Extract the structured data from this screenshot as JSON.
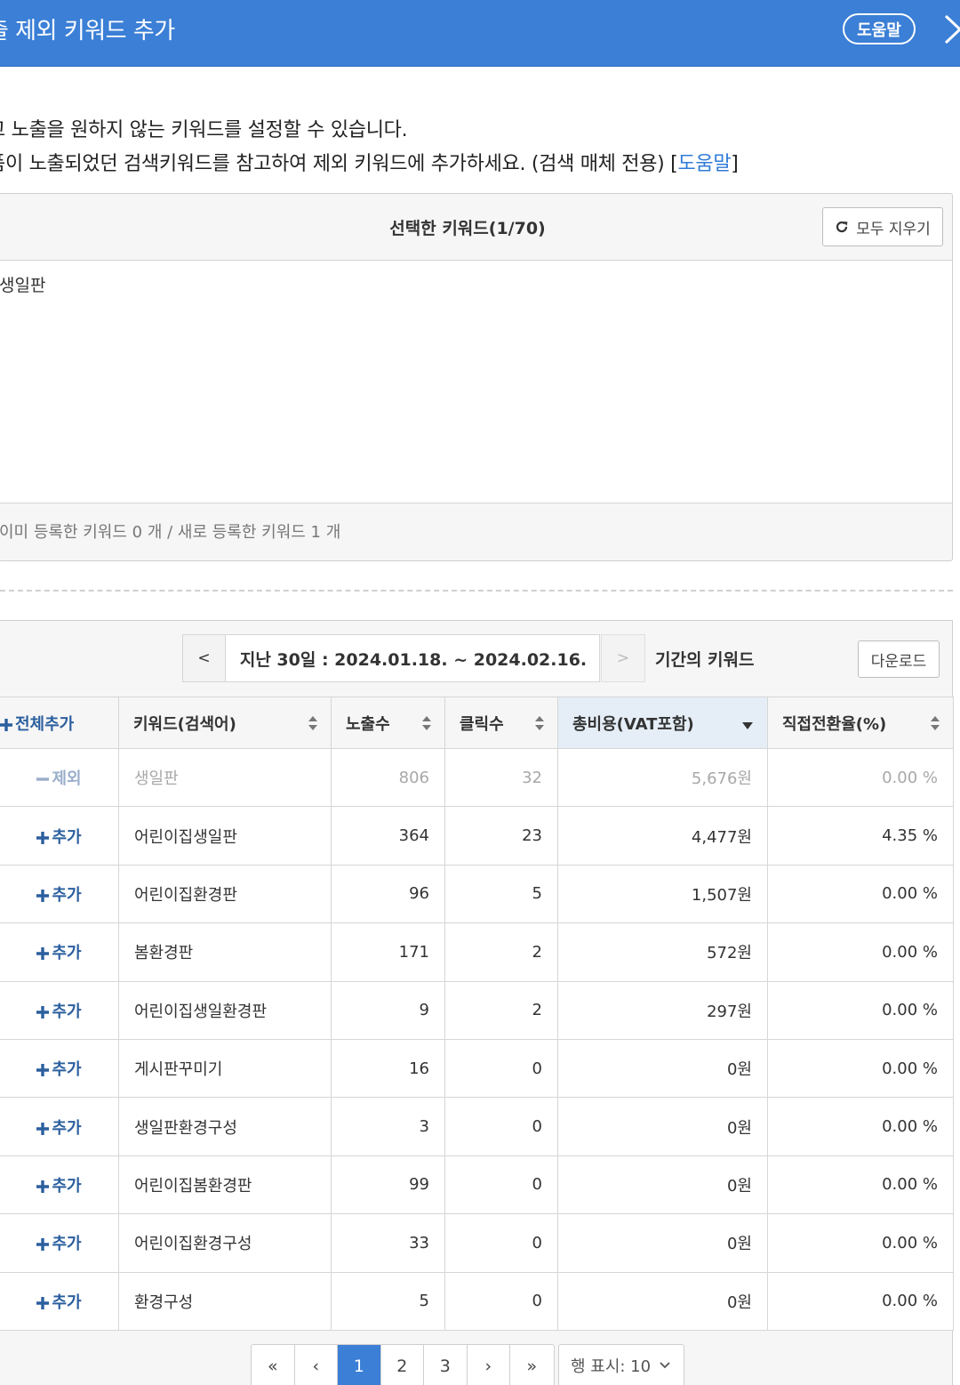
{
  "header": {
    "title": "출 제외 키워드 추가",
    "help_label": "도움말"
  },
  "description": {
    "line1": "고 노출을 원하지 않는 키워드를 설정할 수 있습니다.",
    "line2_text": "품이 노출되었던 검색키워드를 참고하여 제외 키워드에 추가하세요. (검색 매체 전용) [",
    "line2_link": "도움말",
    "line2_end": "]"
  },
  "selected": {
    "title": "선택한 키워드(1/70)",
    "clear_label": "모두 지우기",
    "keywords": [
      "생일판"
    ],
    "footer": "이미 등록한 키워드 0 개 / 새로 등록한 키워드 1 개"
  },
  "period": {
    "prev": "<",
    "range": "지난 30일 : 2024.01.18. ~ 2024.02.16.",
    "next": ">",
    "label": "기간의 키워드",
    "download_label": "다운로드"
  },
  "table": {
    "headers": {
      "add_all": "전체추가",
      "keyword": "키워드(검색어)",
      "impressions": "노출수",
      "clicks": "클릭수",
      "cost": "총비용(VAT포함)",
      "conversion": "직접전환율(%)"
    },
    "rows": [
      {
        "action": "제외",
        "keyword": "생일판",
        "impressions": "806",
        "clicks": "32",
        "cost": "5,676원",
        "conversion": "0.00 %"
      },
      {
        "action": "추가",
        "keyword": "어린이집생일판",
        "impressions": "364",
        "clicks": "23",
        "cost": "4,477원",
        "conversion": "4.35 %"
      },
      {
        "action": "추가",
        "keyword": "어린이집환경판",
        "impressions": "96",
        "clicks": "5",
        "cost": "1,507원",
        "conversion": "0.00 %"
      },
      {
        "action": "추가",
        "keyword": "봄환경판",
        "impressions": "171",
        "clicks": "2",
        "cost": "572원",
        "conversion": "0.00 %"
      },
      {
        "action": "추가",
        "keyword": "어린이집생일환경판",
        "impressions": "9",
        "clicks": "2",
        "cost": "297원",
        "conversion": "0.00 %"
      },
      {
        "action": "추가",
        "keyword": "게시판꾸미기",
        "impressions": "16",
        "clicks": "0",
        "cost": "0원",
        "conversion": "0.00 %"
      },
      {
        "action": "추가",
        "keyword": "생일판환경구성",
        "impressions": "3",
        "clicks": "0",
        "cost": "0원",
        "conversion": "0.00 %"
      },
      {
        "action": "추가",
        "keyword": "어린이집봄환경판",
        "impressions": "99",
        "clicks": "0",
        "cost": "0원",
        "conversion": "0.00 %"
      },
      {
        "action": "추가",
        "keyword": "어린이집환경구성",
        "impressions": "33",
        "clicks": "0",
        "cost": "0원",
        "conversion": "0.00 %"
      },
      {
        "action": "추가",
        "keyword": "환경구성",
        "impressions": "5",
        "clicks": "0",
        "cost": "0원",
        "conversion": "0.00 %"
      }
    ]
  },
  "pagination": {
    "first": "«",
    "prev": "‹",
    "pages": [
      "1",
      "2",
      "3"
    ],
    "current": "1",
    "next": "›",
    "last": "»",
    "rows_label": "행 표시: 10"
  },
  "colors": {
    "header_bg": "#3b7fd6",
    "link": "#2f7bd6",
    "action": "#2b5f9e"
  }
}
